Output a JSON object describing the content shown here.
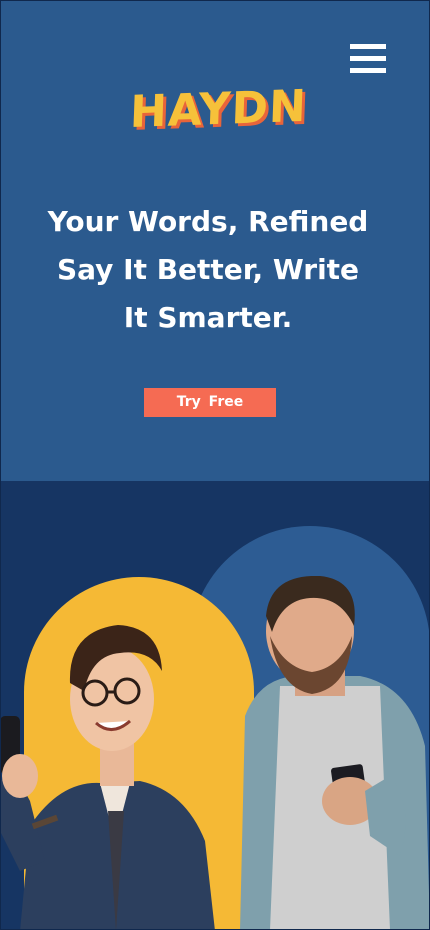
{
  "header": {
    "menu_icon": "hamburger-menu-icon",
    "logo_text": "HAYDN"
  },
  "hero": {
    "headline_lines": [
      "Your Words, Refined",
      "Say It Better, Write",
      "It Smarter."
    ],
    "cta_label": "Try Free"
  },
  "colors": {
    "hero_bg": "#2b5a8e",
    "lower_bg": "#163563",
    "cta_bg": "#f56b53",
    "logo_yellow": "#f6c13a",
    "logo_shadow": "#e8643a",
    "arch_yellow": "#f5b935",
    "arch_blue": "#2d5c93"
  },
  "images": {
    "left_person": "young man with glasses smiling at phone",
    "right_person": "bearded man looking at phone"
  }
}
